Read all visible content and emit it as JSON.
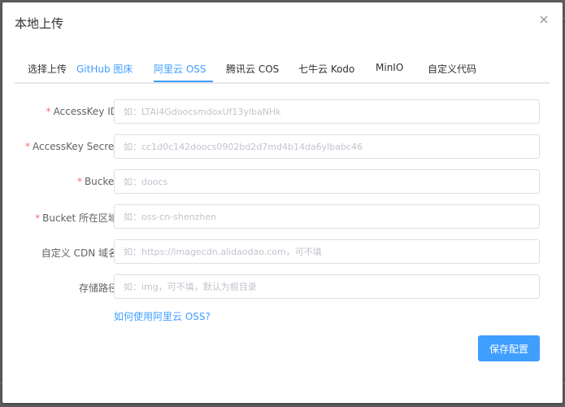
{
  "dialog": {
    "title": "本地上传"
  },
  "tabs": [
    {
      "label": "选择上传",
      "color": "#303133"
    },
    {
      "label": "GitHub 图床",
      "color": "#409eff"
    },
    {
      "label": "阿里云 OSS",
      "color": "#409eff"
    },
    {
      "label": "腾讯云 COS",
      "color": "#303133"
    },
    {
      "label": "七牛云 Kodo",
      "color": "#303133"
    },
    {
      "label": "MinIO",
      "color": "#303133"
    },
    {
      "label": "自定义代码",
      "color": "#303133"
    }
  ],
  "active_tab": "阿里云 OSS",
  "form": {
    "access_key_id": {
      "label": "AccessKey ID",
      "required": true,
      "placeholder": "如：LTAI4GdoocsmdoxUf13ylbaNHk"
    },
    "access_key_secret": {
      "label": "AccessKey Secret",
      "required": true,
      "placeholder": "如：cc1d0c142doocs0902bd2d7md4b14da6ylbabc46"
    },
    "bucket": {
      "label": "Bucket",
      "required": true,
      "placeholder": "如：doocs"
    },
    "region": {
      "label": "Bucket 所在区域",
      "required": true,
      "placeholder": "如：oss-cn-shenzhen"
    },
    "cdn_domain": {
      "label": "自定义 CDN 域名",
      "required": false,
      "placeholder": "如：https://imagecdn.alidaodao.com，可不填"
    },
    "path": {
      "label": "存储路径",
      "required": false,
      "placeholder": "如：img，可不填，默认为根目录"
    }
  },
  "help_link": "如何使用阿里云 OSS?",
  "save_button": "保存配置",
  "colors": {
    "accent": "#409eff",
    "required": "#f56c6c",
    "border": "#dcdfe6"
  },
  "icons": {
    "close": "close-icon"
  }
}
